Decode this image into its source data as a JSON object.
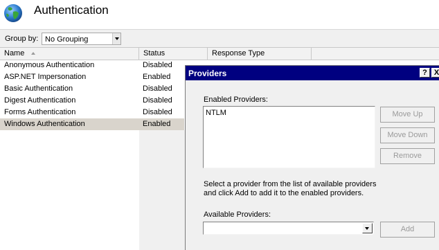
{
  "header": {
    "title": "Authentication",
    "icon": "globe-icon"
  },
  "toolbar": {
    "group_by_label": "Group by:",
    "group_by_value": "No Grouping"
  },
  "list": {
    "columns": [
      "Name",
      "Status",
      "Response Type"
    ],
    "rows": [
      {
        "name": "Anonymous Authentication",
        "status": "Disabled"
      },
      {
        "name": "ASP.NET Impersonation",
        "status": "Enabled"
      },
      {
        "name": "Basic Authentication",
        "status": "Disabled"
      },
      {
        "name": "Digest Authentication",
        "status": "Disabled"
      },
      {
        "name": "Forms Authentication",
        "status": "Disabled"
      },
      {
        "name": "Windows Authentication",
        "status": "Enabled"
      }
    ],
    "selected_row": "Windows Authentication"
  },
  "dialog": {
    "title": "Providers",
    "help_label": "?",
    "close_label": "X",
    "enabled_label": "Enabled Providers:",
    "enabled_providers": [
      "NTLM"
    ],
    "move_up": "Move Up",
    "move_down": "Move Down",
    "remove": "Remove",
    "instructions_line1": "Select a provider from the list of available providers",
    "instructions_line2": "and click Add to add it to the enabled providers.",
    "available_label": "Available Providers:",
    "available_value": "",
    "add": "Add"
  },
  "colors": {
    "titlebar": "#000080",
    "selected_row": "#d9d4cc",
    "dialog_bg": "#f0f0f0"
  }
}
